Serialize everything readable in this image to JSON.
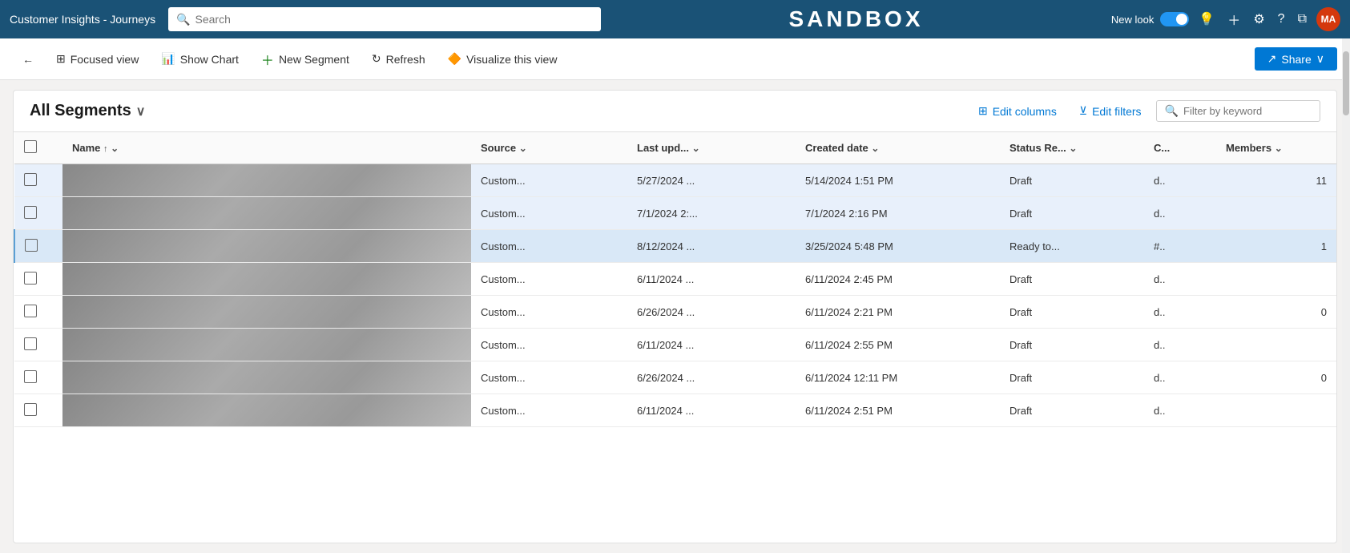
{
  "app": {
    "title": "Customer Insights - Journeys",
    "logo": "SANDBOX",
    "search_placeholder": "Search",
    "new_look_label": "New look",
    "avatar_initials": "MA"
  },
  "toolbar": {
    "back_label": "←",
    "focused_view_label": "Focused view",
    "show_chart_label": "Show Chart",
    "new_segment_label": "New Segment",
    "refresh_label": "Refresh",
    "visualize_label": "Visualize this view",
    "share_label": "Share"
  },
  "content": {
    "title": "All Segments",
    "edit_columns_label": "Edit columns",
    "edit_filters_label": "Edit filters",
    "filter_placeholder": "Filter by keyword"
  },
  "table": {
    "columns": [
      {
        "id": "check",
        "label": ""
      },
      {
        "id": "name",
        "label": "Name",
        "sort": "↑",
        "has_filter": true
      },
      {
        "id": "source",
        "label": "Source",
        "has_filter": true
      },
      {
        "id": "lastupd",
        "label": "Last upd...",
        "has_filter": true
      },
      {
        "id": "created",
        "label": "Created date",
        "has_filter": true
      },
      {
        "id": "status",
        "label": "Status Re...",
        "has_filter": true
      },
      {
        "id": "c",
        "label": "C..."
      },
      {
        "id": "members",
        "label": "Members",
        "has_filter": true
      }
    ],
    "rows": [
      {
        "source": "Custom...",
        "lastupd": "5/27/2024 ...",
        "created": "5/14/2024 1:51 PM",
        "status": "Draft",
        "c": "d..",
        "members": "11",
        "selected": false,
        "highlighted": true
      },
      {
        "source": "Custom...",
        "lastupd": "7/1/2024 2:...",
        "created": "7/1/2024 2:16 PM",
        "status": "Draft",
        "c": "d..",
        "members": "",
        "selected": false,
        "highlighted": true
      },
      {
        "source": "Custom...",
        "lastupd": "8/12/2024 ...",
        "created": "3/25/2024 5:48 PM",
        "status": "Ready to...",
        "c": "#..",
        "members": "1",
        "selected": false,
        "highlighted": true
      },
      {
        "source": "Custom...",
        "lastupd": "6/11/2024 ...",
        "created": "6/11/2024 2:45 PM",
        "status": "Draft",
        "c": "d..",
        "members": "",
        "selected": false,
        "highlighted": false
      },
      {
        "source": "Custom...",
        "lastupd": "6/26/2024 ...",
        "created": "6/11/2024 2:21 PM",
        "status": "Draft",
        "c": "d..",
        "members": "0",
        "selected": false,
        "highlighted": false
      },
      {
        "source": "Custom...",
        "lastupd": "6/11/2024 ...",
        "created": "6/11/2024 2:55 PM",
        "status": "Draft",
        "c": "d..",
        "members": "",
        "selected": false,
        "highlighted": false
      },
      {
        "source": "Custom...",
        "lastupd": "6/26/2024 ...",
        "created": "6/11/2024 12:11 PM",
        "status": "Draft",
        "c": "d..",
        "members": "0",
        "selected": false,
        "highlighted": false
      },
      {
        "source": "Custom...",
        "lastupd": "6/11/2024 ...",
        "created": "6/11/2024 2:51 PM",
        "status": "Draft",
        "c": "d..",
        "members": "",
        "selected": false,
        "highlighted": false
      }
    ]
  }
}
